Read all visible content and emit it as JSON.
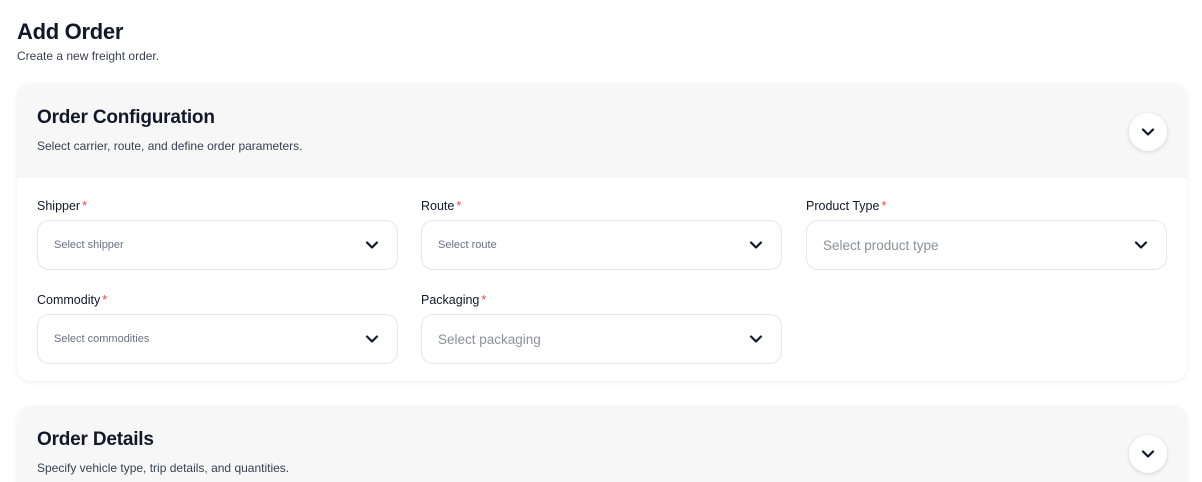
{
  "header": {
    "title": "Add Order",
    "subtitle": "Create a new freight order."
  },
  "sections": [
    {
      "title": "Order Configuration",
      "description": "Select carrier, route, and define order parameters.",
      "toggle_icon": "chevron-down-icon",
      "fields": [
        {
          "label": "Shipper",
          "required_mark": "*",
          "placeholder": "Select shipper"
        },
        {
          "label": "Route",
          "required_mark": "*",
          "placeholder": "Select route"
        },
        {
          "label": "Product Type",
          "required_mark": "*",
          "placeholder": "Select product type"
        },
        {
          "label": "Commodity",
          "required_mark": "*",
          "placeholder": "Select commodities"
        },
        {
          "label": "Packaging",
          "required_mark": "*",
          "placeholder": "Select packaging"
        }
      ]
    },
    {
      "title": "Order Details",
      "description": "Specify vehicle type, trip details, and quantities.",
      "toggle_icon": "chevron-down-icon"
    }
  ],
  "colors": {
    "required": "#ef4444",
    "card_header_bg": "#f7f7f7",
    "text": "#111827"
  }
}
